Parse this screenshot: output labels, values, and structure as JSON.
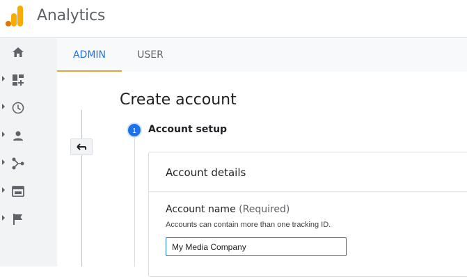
{
  "header": {
    "title": "Analytics"
  },
  "sidebar": {
    "items": [
      {
        "icon": "home-icon",
        "expandable": false
      },
      {
        "icon": "customization-icon",
        "expandable": true
      },
      {
        "icon": "realtime-clock-icon",
        "expandable": true
      },
      {
        "icon": "audience-person-icon",
        "expandable": true
      },
      {
        "icon": "acquisition-icon",
        "expandable": true
      },
      {
        "icon": "behavior-icon",
        "expandable": true
      },
      {
        "icon": "conversions-flag-icon",
        "expandable": true
      }
    ]
  },
  "tabs": [
    {
      "label": "ADMIN",
      "active": true
    },
    {
      "label": "USER",
      "active": false
    }
  ],
  "main": {
    "title": "Create account",
    "step": {
      "number": "1",
      "label": "Account setup"
    },
    "card": {
      "title": "Account details",
      "field": {
        "label": "Account name",
        "required": "(Required)",
        "hint": "Accounts can contain more than one tracking ID.",
        "value": "My Media Company"
      }
    }
  },
  "colors": {
    "accent": "#1a73e8",
    "tab_underline": "#e8a33d",
    "logo_orange": "#f9ab00",
    "logo_dark": "#e37400"
  }
}
